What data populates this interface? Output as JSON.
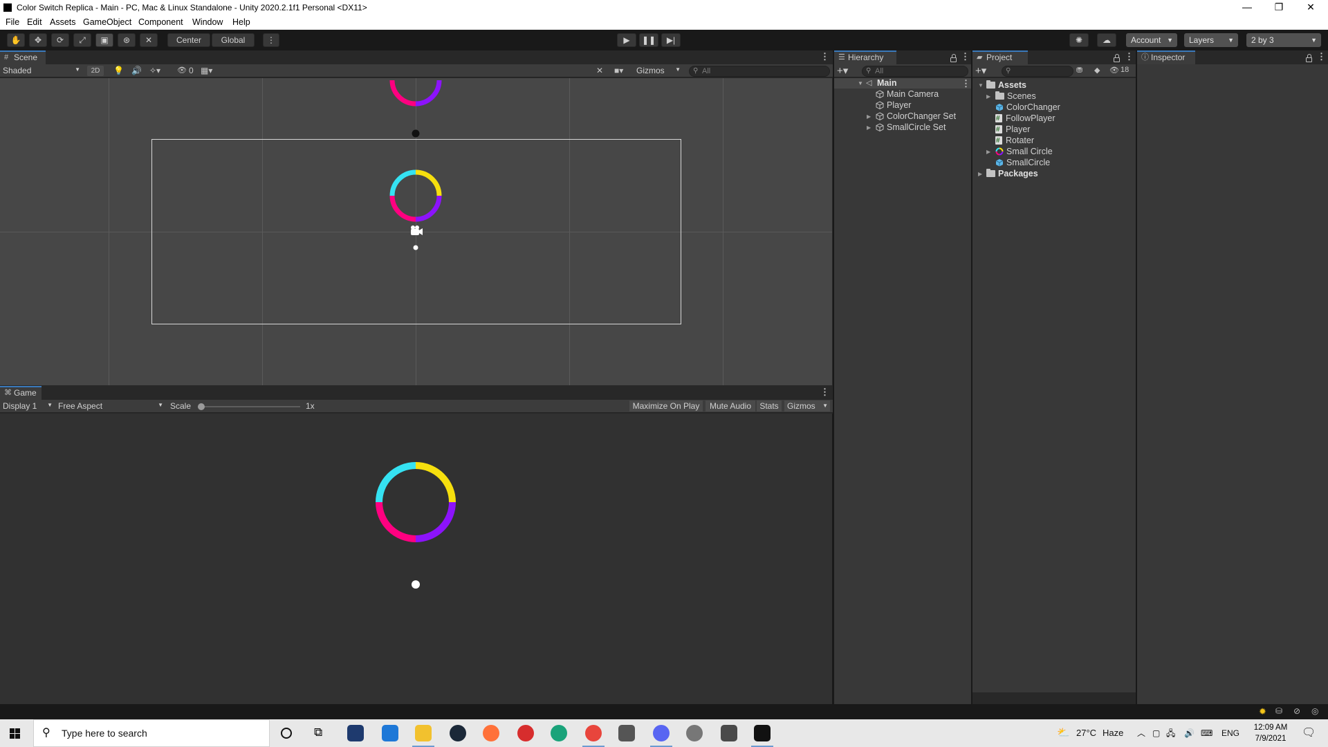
{
  "window": {
    "title": "Color Switch Replica - Main - PC, Mac & Linux Standalone - Unity 2020.2.1f1 Personal <DX11>",
    "minimize": "—",
    "restore": "❐",
    "close": "✕"
  },
  "menu": [
    "File",
    "Edit",
    "Assets",
    "GameObject",
    "Component",
    "Window",
    "Help"
  ],
  "toolbar": {
    "pivot_mode": "Center",
    "pivot_rotation": "Global",
    "account": "Account",
    "layers": "Layers",
    "layout": "2 by 3"
  },
  "scene_panel": {
    "tab": "Scene",
    "shading": "Shaded",
    "mode_2d": "2D",
    "hidden_count": "0",
    "gizmos": "Gizmos",
    "search_placeholder": "All"
  },
  "game_panel": {
    "tab": "Game",
    "display": "Display 1",
    "aspect": "Free Aspect",
    "scale_label": "Scale",
    "scale_value": "1x",
    "scale_level": 0,
    "maximize": "Maximize On Play",
    "mute": "Mute Audio",
    "stats": "Stats",
    "gizmos": "Gizmos"
  },
  "hierarchy": {
    "tab": "Hierarchy",
    "search_placeholder": "All",
    "scene": "Main",
    "items": [
      {
        "label": "Main Camera",
        "expandable": false
      },
      {
        "label": "Player",
        "expandable": false
      },
      {
        "label": "ColorChanger Set",
        "expandable": true
      },
      {
        "label": "SmallCircle Set",
        "expandable": true
      }
    ]
  },
  "project": {
    "tab": "Project",
    "hidden_count": "18",
    "root": "Assets",
    "items": [
      {
        "label": "Scenes",
        "kind": "folder"
      },
      {
        "label": "ColorChanger",
        "kind": "prefab"
      },
      {
        "label": "FollowPlayer",
        "kind": "script"
      },
      {
        "label": "Player",
        "kind": "script"
      },
      {
        "label": "Rotater",
        "kind": "script"
      },
      {
        "label": "Small Circle",
        "kind": "sprite"
      },
      {
        "label": "SmallCircle",
        "kind": "prefab"
      }
    ],
    "packages": "Packages"
  },
  "inspector": {
    "tab": "Inspector"
  },
  "taskbar": {
    "search_placeholder": "Type here to search",
    "weather_temp": "27°C",
    "weather_text": "Haze",
    "lang": "ENG",
    "time": "12:09 AM",
    "date": "7/9/2021"
  },
  "colors": {
    "cyan": "#35e2f2",
    "yellow": "#f6df0e",
    "purple": "#8c13fb",
    "magenta": "#ff0080",
    "accent": "#3a79bb"
  }
}
